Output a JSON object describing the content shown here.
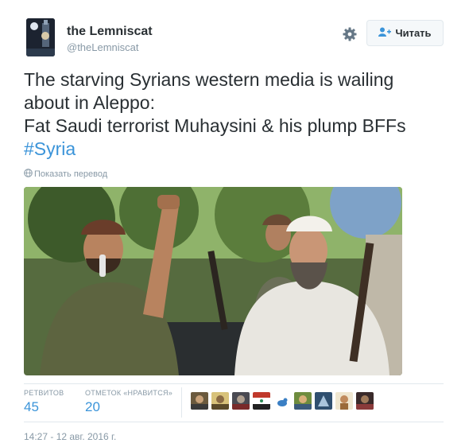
{
  "header": {
    "display_name": "the Lemniscat",
    "handle": "@theLemniscat",
    "avatar_icon": "lemniscat-profile-avatar",
    "settings_icon": "gear-icon",
    "follow_label": "Читать",
    "follow_icon": "add-user-icon"
  },
  "tweet": {
    "lines": [
      "The starving Syrians western media is wailing",
      "about in Aleppo:",
      "Fat Saudi terrorist Muhaysini & his plump BFFs"
    ],
    "hashtag": "#Syria",
    "translate_label": "Показать перевод",
    "translate_icon": "globe-icon",
    "media_icon": "attached-photo"
  },
  "stats": {
    "retweets_label": "РЕТВИТОВ",
    "retweets_count": "45",
    "likes_label": "ОТМЕТОК «НРАВИТСЯ»",
    "likes_count": "20",
    "liker_avatars": 9
  },
  "footer": {
    "timestamp": "14:27 - 12 авг. 2016 г."
  },
  "colors": {
    "link": "#3b94d9",
    "text": "#292f33",
    "muted": "#8899a6",
    "border": "#e1e8ed"
  }
}
